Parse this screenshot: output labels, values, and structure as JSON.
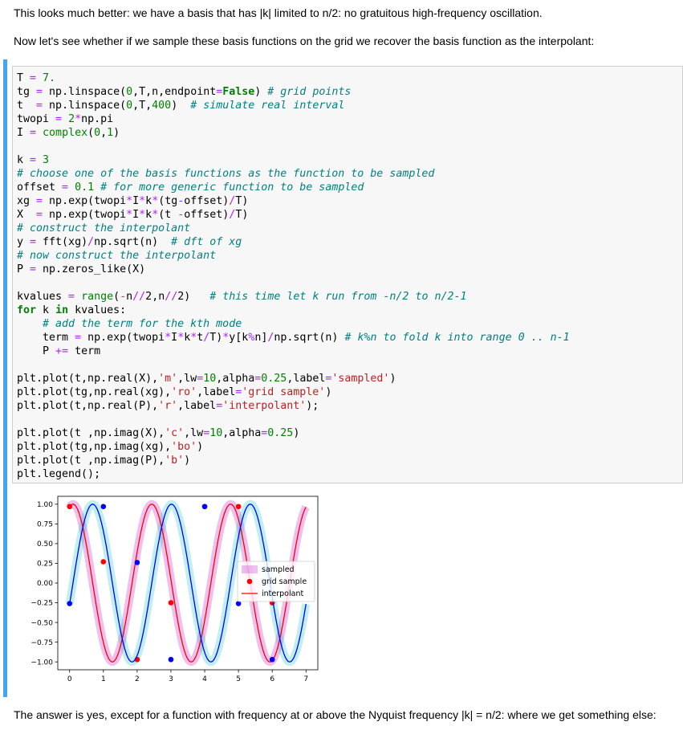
{
  "intro_1": "This looks much better: we have a basis that has |k| limited to n/2: no gratuitous high-frequency oscillation.",
  "intro_2": "Now let's see whether if we sample these basis functions on the grid we recover the basis function as the interpolant:",
  "outro": "The answer is yes, except for a function with frequency at or above the Nyquist frequency |k| = n/2: where we get something else:",
  "code_lines": [
    [
      [
        "T ",
        ""
      ],
      [
        "=",
        "o"
      ],
      [
        " ",
        ""
      ],
      [
        "7.",
        "n"
      ]
    ],
    [
      [
        "tg ",
        ""
      ],
      [
        "=",
        "o"
      ],
      [
        " np.linspace(",
        ""
      ],
      [
        "0",
        "n"
      ],
      [
        ",T,n,endpoint",
        ""
      ],
      [
        "=",
        "o"
      ],
      [
        "False",
        "k"
      ],
      [
        ") ",
        ""
      ],
      [
        "# grid points",
        "c"
      ]
    ],
    [
      [
        "t  ",
        ""
      ],
      [
        "=",
        "o"
      ],
      [
        " np.linspace(",
        ""
      ],
      [
        "0",
        "n"
      ],
      [
        ",T,",
        ""
      ],
      [
        "400",
        "n"
      ],
      [
        ")  ",
        ""
      ],
      [
        "# simulate real interval",
        "c"
      ]
    ],
    [
      [
        "twopi ",
        ""
      ],
      [
        "=",
        "o"
      ],
      [
        " ",
        ""
      ],
      [
        "2",
        "n"
      ],
      [
        "*",
        "o"
      ],
      [
        "np.pi",
        ""
      ]
    ],
    [
      [
        "I ",
        ""
      ],
      [
        "=",
        "o"
      ],
      [
        " ",
        ""
      ],
      [
        "complex",
        "b"
      ],
      [
        "(",
        ""
      ],
      [
        "0",
        "n"
      ],
      [
        ",",
        ""
      ],
      [
        "1",
        "n"
      ],
      [
        ")",
        ""
      ]
    ],
    [],
    [
      [
        "k ",
        ""
      ],
      [
        "=",
        "o"
      ],
      [
        " ",
        ""
      ],
      [
        "3",
        "n"
      ]
    ],
    [
      [
        "# choose one of the basis functions as the function to be sampled",
        "c"
      ]
    ],
    [
      [
        "offset ",
        ""
      ],
      [
        "=",
        "o"
      ],
      [
        " ",
        ""
      ],
      [
        "0.1",
        "n"
      ],
      [
        " ",
        ""
      ],
      [
        "# for more generic function to be sampled",
        "c"
      ]
    ],
    [
      [
        "xg ",
        ""
      ],
      [
        "=",
        "o"
      ],
      [
        " np.exp(twopi",
        ""
      ],
      [
        "*",
        "o"
      ],
      [
        "I",
        ""
      ],
      [
        "*",
        "o"
      ],
      [
        "k",
        ""
      ],
      [
        "*",
        "o"
      ],
      [
        "(tg",
        ""
      ],
      [
        "-",
        "o"
      ],
      [
        "offset)",
        ""
      ],
      [
        "/",
        "o"
      ],
      [
        "T)",
        ""
      ]
    ],
    [
      [
        "X  ",
        ""
      ],
      [
        "=",
        "o"
      ],
      [
        " np.exp(twopi",
        ""
      ],
      [
        "*",
        "o"
      ],
      [
        "I",
        ""
      ],
      [
        "*",
        "o"
      ],
      [
        "k",
        ""
      ],
      [
        "*",
        "o"
      ],
      [
        "(t ",
        ""
      ],
      [
        "-",
        "o"
      ],
      [
        "offset)",
        ""
      ],
      [
        "/",
        "o"
      ],
      [
        "T)",
        ""
      ]
    ],
    [
      [
        "# construct the interpolant",
        "c"
      ]
    ],
    [
      [
        "y ",
        ""
      ],
      [
        "=",
        "o"
      ],
      [
        " fft(xg)",
        ""
      ],
      [
        "/",
        "o"
      ],
      [
        "np.sqrt(n)  ",
        ""
      ],
      [
        "# dft of xg",
        "c"
      ]
    ],
    [
      [
        "# now construct the interpolant",
        "c"
      ]
    ],
    [
      [
        "P ",
        ""
      ],
      [
        "=",
        "o"
      ],
      [
        " np.zeros_like(X)",
        ""
      ]
    ],
    [],
    [
      [
        "kvalues ",
        ""
      ],
      [
        "=",
        "o"
      ],
      [
        " ",
        ""
      ],
      [
        "range",
        "b"
      ],
      [
        "(",
        ""
      ],
      [
        "-",
        "o"
      ],
      [
        "n",
        ""
      ],
      [
        "//",
        "o"
      ],
      [
        "2",
        ""
      ],
      [
        ",n",
        ""
      ],
      [
        "//",
        "o"
      ],
      [
        "2",
        ""
      ],
      [
        ")   ",
        ""
      ],
      [
        "# this time let k run from -n/2 to n/2-1",
        "c"
      ]
    ],
    [
      [
        "for",
        "k"
      ],
      [
        " k ",
        ""
      ],
      [
        "in",
        "k"
      ],
      [
        " kvalues:",
        ""
      ]
    ],
    [
      [
        "    ",
        ""
      ],
      [
        "# add the term for the kth mode",
        "c"
      ]
    ],
    [
      [
        "    term ",
        ""
      ],
      [
        "=",
        "o"
      ],
      [
        " np.exp(twopi",
        ""
      ],
      [
        "*",
        "o"
      ],
      [
        "I",
        ""
      ],
      [
        "*",
        "o"
      ],
      [
        "k",
        ""
      ],
      [
        "*",
        "o"
      ],
      [
        "t",
        ""
      ],
      [
        "/",
        "o"
      ],
      [
        "T)",
        ""
      ],
      [
        "*",
        "o"
      ],
      [
        "y[k",
        ""
      ],
      [
        "%",
        "o"
      ],
      [
        "n]",
        ""
      ],
      [
        "/",
        "o"
      ],
      [
        "np.sqrt(n) ",
        ""
      ],
      [
        "# k%n to fold k into range 0 .. n-1",
        "c"
      ]
    ],
    [
      [
        "    P ",
        ""
      ],
      [
        "+=",
        "o"
      ],
      [
        " term",
        ""
      ]
    ],
    [],
    [
      [
        "plt.plot(t,np.real(X),",
        ""
      ],
      [
        "'m'",
        "s"
      ],
      [
        ",lw",
        ""
      ],
      [
        "=",
        "o"
      ],
      [
        "10",
        "n"
      ],
      [
        ",alpha",
        ""
      ],
      [
        "=",
        "o"
      ],
      [
        "0.25",
        "n"
      ],
      [
        ",label",
        ""
      ],
      [
        "=",
        "o"
      ],
      [
        "'sampled'",
        "s"
      ],
      [
        ")",
        ""
      ]
    ],
    [
      [
        "plt.plot(tg,np.real(xg),",
        ""
      ],
      [
        "'ro'",
        "s"
      ],
      [
        ",label",
        ""
      ],
      [
        "=",
        "o"
      ],
      [
        "'grid sample'",
        "s"
      ],
      [
        ")",
        ""
      ]
    ],
    [
      [
        "plt.plot(t,np.real(P),",
        ""
      ],
      [
        "'r'",
        "s"
      ],
      [
        ",label",
        ""
      ],
      [
        "=",
        "o"
      ],
      [
        "'interpolant'",
        "s"
      ],
      [
        ");",
        ""
      ]
    ],
    [],
    [
      [
        "plt.plot(t ,np.imag(X),",
        ""
      ],
      [
        "'c'",
        "s"
      ],
      [
        ",lw",
        ""
      ],
      [
        "=",
        "o"
      ],
      [
        "10",
        "n"
      ],
      [
        ",alpha",
        ""
      ],
      [
        "=",
        "o"
      ],
      [
        "0.25",
        "n"
      ],
      [
        ")",
        ""
      ]
    ],
    [
      [
        "plt.plot(tg,np.imag(xg),",
        ""
      ],
      [
        "'bo'",
        "s"
      ],
      [
        ")",
        ""
      ]
    ],
    [
      [
        "plt.plot(t ,np.imag(P),",
        ""
      ],
      [
        "'b'",
        "s"
      ],
      [
        ")",
        ""
      ]
    ],
    [
      [
        "plt.legend();",
        ""
      ]
    ]
  ],
  "chart_data": {
    "type": "line",
    "function": "exp(2*pi*i*k*(t-offset)/T)",
    "params": {
      "T": 7,
      "n": 7,
      "k": 3,
      "offset": 0.1
    },
    "xlim": [
      -0.35,
      7.35
    ],
    "ylim": [
      -1.1,
      1.1
    ],
    "xticks": [
      0,
      1,
      2,
      3,
      4,
      5,
      6,
      7
    ],
    "yticks": [
      1.0,
      0.75,
      0.5,
      0.25,
      0.0,
      -0.25,
      -0.5,
      -0.75,
      -1.0
    ],
    "ytick_labels": [
      "1.00",
      "0.75",
      "0.50",
      "0.25",
      "0.00",
      "−0.25",
      "−0.50",
      "−0.75",
      "−1.00"
    ],
    "grid": false,
    "legend_position": "center-right",
    "legend": [
      "sampled",
      "grid sample",
      "interpolant"
    ],
    "colors": {
      "sampled": "#bf00bf",
      "real": "#ff0000",
      "cyan": "#00bfbf",
      "imag": "#0000ff"
    },
    "grid_sample_real": {
      "x": [
        0,
        1,
        2,
        3,
        4,
        5,
        6
      ],
      "y": [
        0.97,
        0.27,
        -0.97,
        -0.25,
        0.97,
        0.97,
        -0.25
      ]
    },
    "grid_sample_imag": {
      "x": [
        0,
        1,
        2,
        3,
        4,
        5,
        6
      ],
      "y": [
        -0.26,
        0.97,
        0.26,
        -0.97,
        0.97,
        -0.26,
        -0.97
      ]
    }
  }
}
